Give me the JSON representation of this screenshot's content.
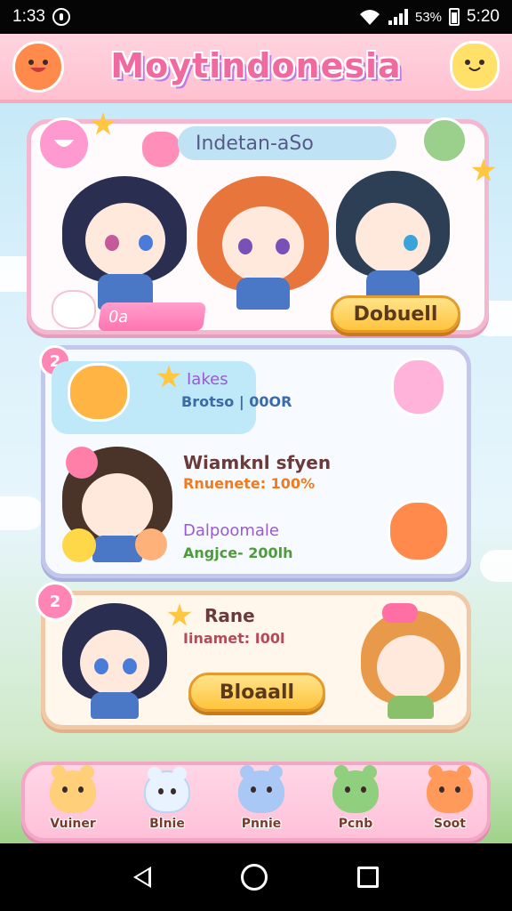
{
  "status_bar": {
    "time_left": "1:33",
    "battery_text": "53%",
    "time_right": "5:20"
  },
  "app": {
    "title": "Moytindonesia"
  },
  "panel_top": {
    "header": "Indetan-aSo",
    "chip_text": "0a",
    "button_label": "Dobuell"
  },
  "panel_quests": {
    "badge": "2",
    "quest1_title": "Iakes",
    "quest1_sub": "Brotso | 00OR",
    "quest2_title": "Wiamknl sfyen",
    "quest2_sub": "Rnuenete: 100%",
    "quest3_title": "Dalpoomale",
    "quest3_sub": "Angjce- 200lh"
  },
  "panel_bottom": {
    "badge": "2",
    "title": "Rane",
    "sub": "Iinamet: I00l",
    "button_label": "Bloaall"
  },
  "bottom_nav": {
    "items": [
      {
        "label": "Vuiner",
        "color": "#ffcf7a"
      },
      {
        "label": "Blnie",
        "color": "#e8f3ff"
      },
      {
        "label": "Pnnie",
        "color": "#a9c8f5"
      },
      {
        "label": "Pcnb",
        "color": "#8fcf7d"
      },
      {
        "label": "Soot",
        "color": "#ff9a5a"
      }
    ]
  }
}
